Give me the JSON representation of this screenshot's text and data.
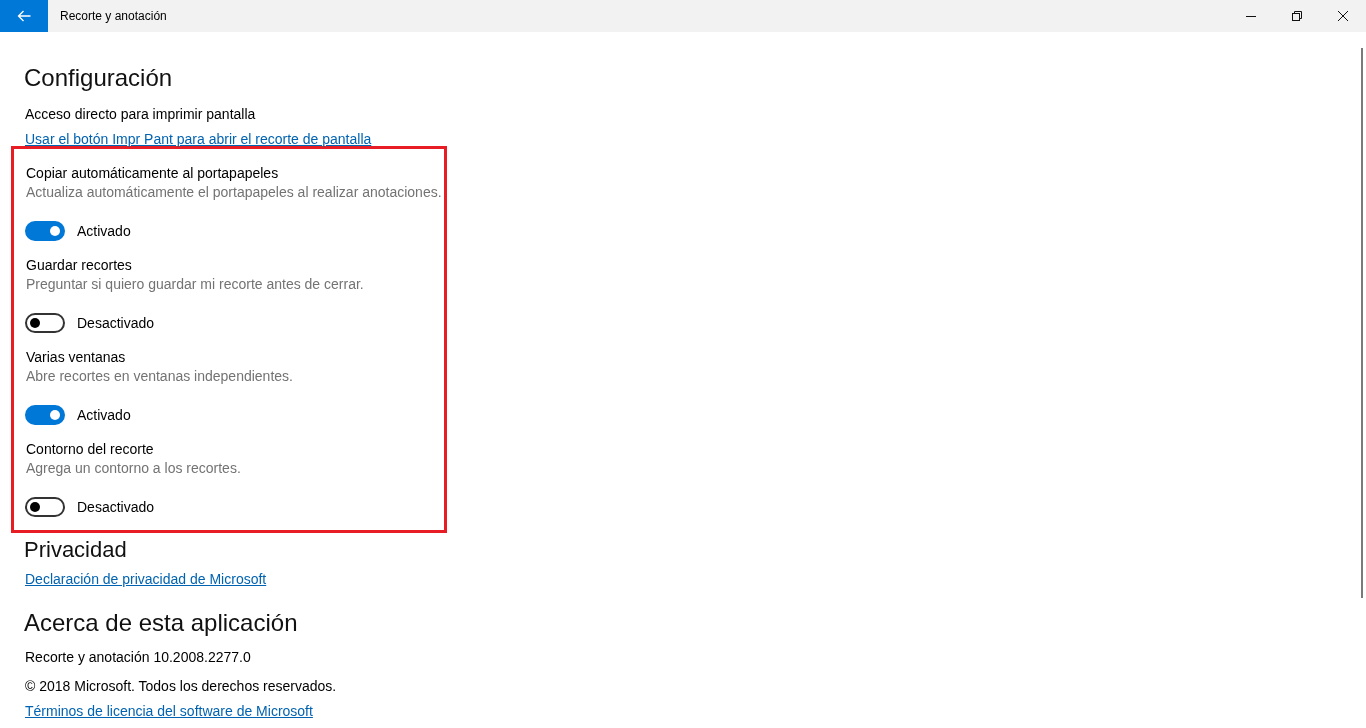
{
  "window": {
    "title": "Recorte y anotación"
  },
  "settings_section": {
    "heading": "Configuración",
    "shortcut": {
      "label": "Acceso directo para imprimir pantalla",
      "link": "Usar el botón Impr Pant para abrir el recorte de pantalla"
    },
    "toggles": [
      {
        "title": "Copiar automáticamente al portapapeles",
        "description": "Actualiza automáticamente el portapapeles al realizar anotaciones.",
        "on": true,
        "state_label": "Activado"
      },
      {
        "title": "Guardar recortes",
        "description": "Preguntar si quiero guardar mi recorte antes de cerrar.",
        "on": false,
        "state_label": "Desactivado"
      },
      {
        "title": "Varias ventanas",
        "description": "Abre recortes en ventanas independientes.",
        "on": true,
        "state_label": "Activado"
      },
      {
        "title": "Contorno del recorte",
        "description": "Agrega un contorno a los recortes.",
        "on": false,
        "state_label": "Desactivado"
      }
    ]
  },
  "privacy_section": {
    "heading": "Privacidad",
    "link": "Declaración de privacidad de Microsoft"
  },
  "about_section": {
    "heading": "Acerca de esta aplicación",
    "version": "Recorte y anotación 10.2008.2277.0",
    "copyright": "© 2018 Microsoft. Todos los derechos reservados.",
    "license_link": "Términos de licencia del software de Microsoft"
  }
}
